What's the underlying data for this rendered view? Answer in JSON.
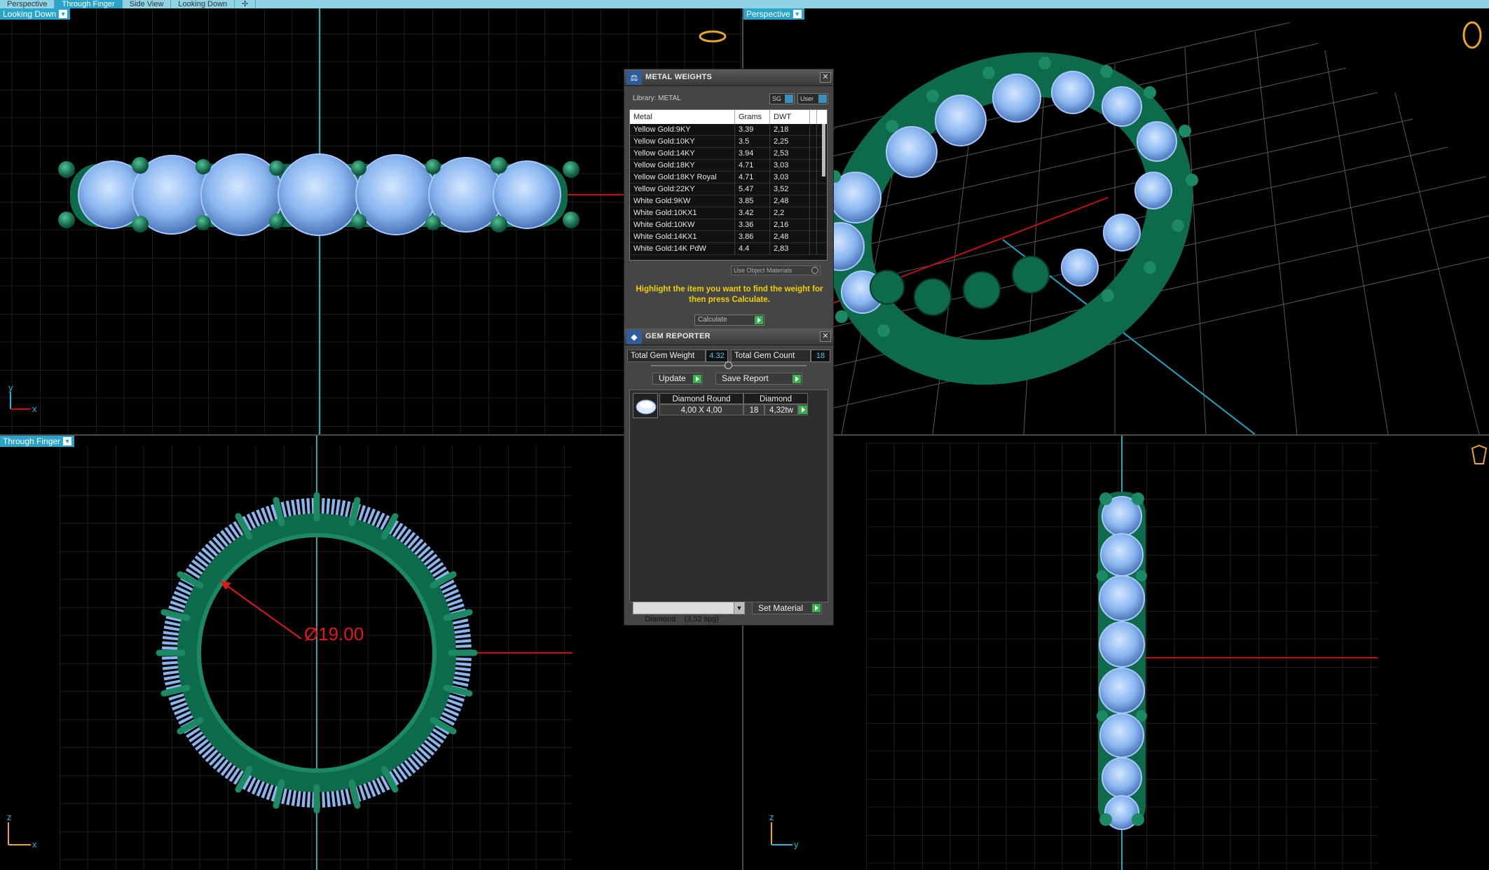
{
  "tabs": [
    "Perspective",
    "Through Finger",
    "Side View",
    "Looking Down"
  ],
  "viewports": {
    "top_left_label": "Looking Down",
    "top_right_label": "Perspective",
    "bottom_left_label": "Through Finger",
    "dimension_text": "Ø19.00",
    "axis_x": "x",
    "axis_y": "y",
    "axis_z": "z"
  },
  "metal_weights": {
    "title": "METAL WEIGHTS",
    "library_label": "Library: METAL",
    "sg_chip": "SG",
    "user_chip": "User",
    "columns": [
      "Metal",
      "Grams",
      "DWT"
    ],
    "rows": [
      [
        "Yellow Gold:9KY",
        "3.39",
        "2,18"
      ],
      [
        "Yellow Gold:10KY",
        "3.5",
        "2,25"
      ],
      [
        "Yellow Gold:14KY",
        "3.94",
        "2,53"
      ],
      [
        "Yellow Gold:18KY",
        "4.71",
        "3,03"
      ],
      [
        "Yellow Gold:18KY Royal",
        "4.71",
        "3,03"
      ],
      [
        "Yellow Gold:22KY",
        "5.47",
        "3,52"
      ],
      [
        "White Gold:9KW",
        "3.85",
        "2,48"
      ],
      [
        "White Gold:10KX1",
        "3.42",
        "2,2"
      ],
      [
        "White Gold:10KW",
        "3.36",
        "2,16"
      ],
      [
        "White Gold:14KX1",
        "3.86",
        "2,48"
      ],
      [
        "White Gold:14K PdW",
        "4.4",
        "2,83"
      ]
    ],
    "use_object_materials": "Use Object Materials",
    "hint": "Highlight the item you want to find the weight for then press Calculate.",
    "calculate": "Calculate"
  },
  "gem_reporter": {
    "title": "GEM REPORTER",
    "total_weight_label": "Total Gem Weight",
    "total_weight": "4.32",
    "total_count_label": "Total Gem Count",
    "total_count": "18",
    "update": "Update",
    "save_report": "Save Report",
    "gem": {
      "shape": "Diamond Round",
      "material": "Diamond",
      "size": "4,00 X 4,00",
      "count": "18",
      "carats": "4,32tw"
    },
    "material_select": "Diamond    (3,52 spg)",
    "set_material": "Set Material"
  },
  "colors": {
    "metal_green": "#0d6b4c",
    "gem_blue": "#8ab6f0",
    "accent": "#2aa4c8",
    "hint_yellow": "#f0d000",
    "dimension_red": "#e01818"
  }
}
